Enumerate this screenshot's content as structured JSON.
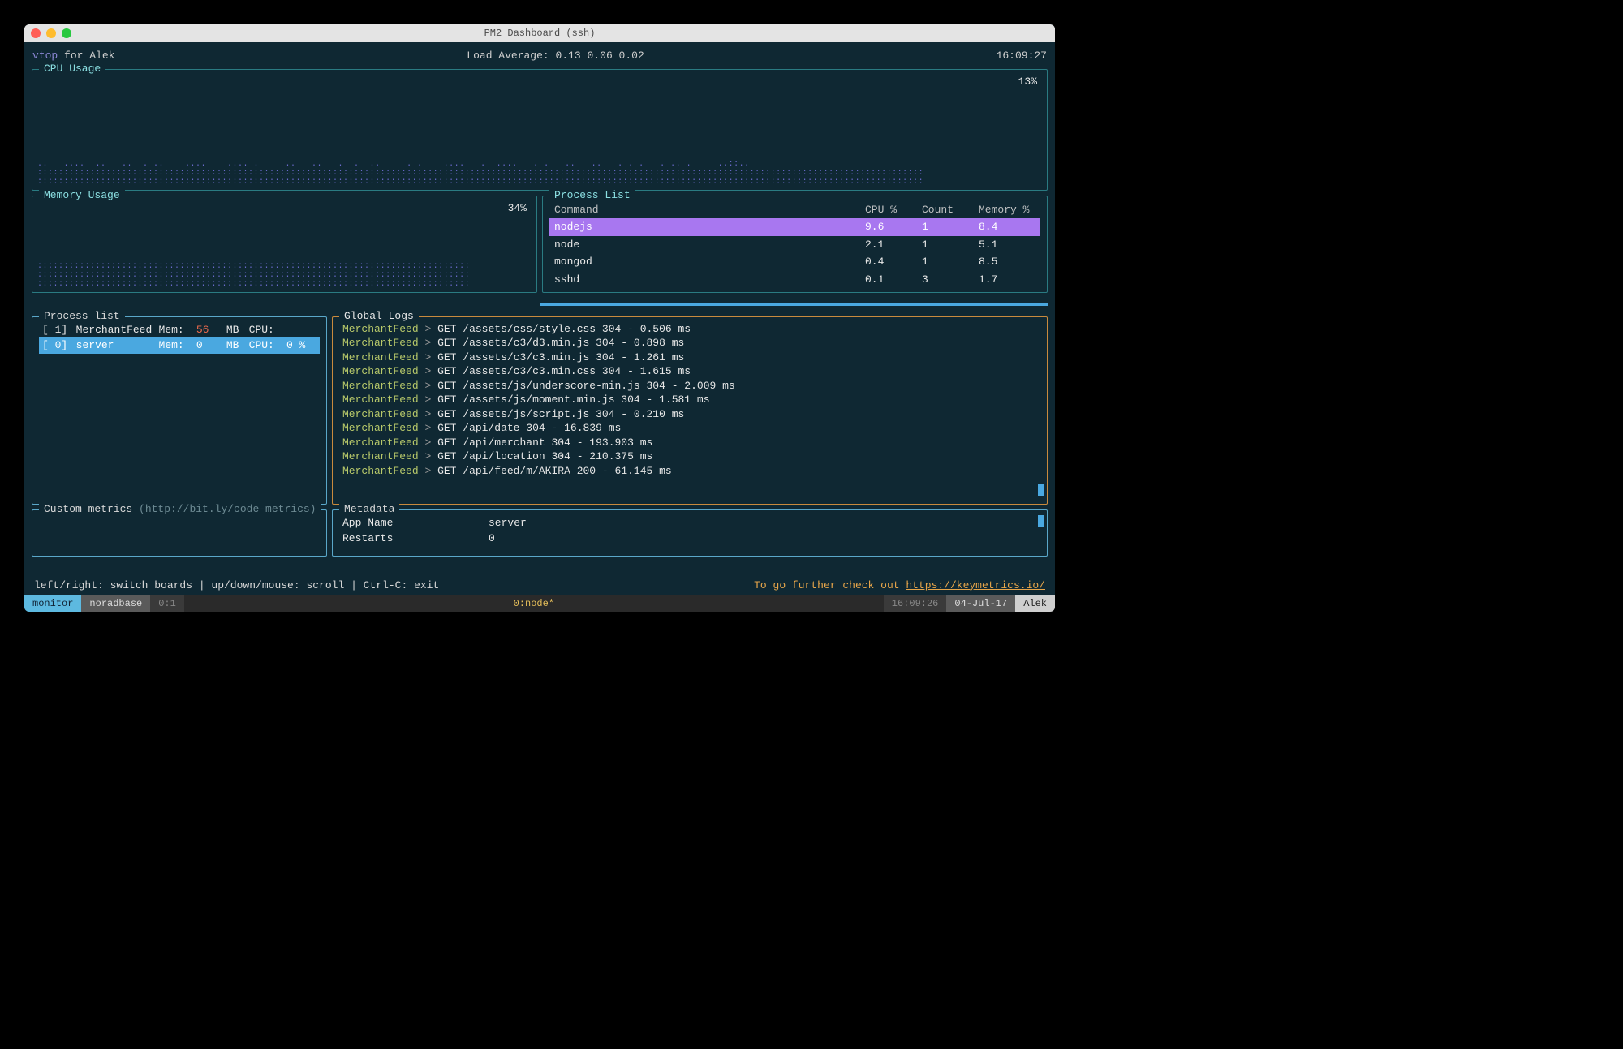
{
  "window": {
    "title": "PM2 Dashboard (ssh)"
  },
  "header": {
    "app": "vtop",
    "for": "for",
    "user": "Alek",
    "load_label": "Load Average:",
    "load": "0.13 0.06 0.02",
    "clock": "16:09:27"
  },
  "cpu": {
    "title": "CPU Usage",
    "pct": "13%"
  },
  "mem": {
    "title": "Memory Usage",
    "pct": "34%"
  },
  "proclist": {
    "title": "Process List",
    "head": {
      "cmd": "Command",
      "cpu": "CPU %",
      "count": "Count",
      "mem": "Memory %"
    },
    "rows": [
      {
        "cmd": "nodejs",
        "cpu": "9.6",
        "count": "1",
        "mem": "8.4",
        "sel": true
      },
      {
        "cmd": "node",
        "cpu": "2.1",
        "count": "1",
        "mem": "5.1"
      },
      {
        "cmd": "mongod",
        "cpu": "0.4",
        "count": "1",
        "mem": "8.5"
      },
      {
        "cmd": "sshd",
        "cpu": "0.1",
        "count": "3",
        "mem": "1.7"
      }
    ]
  },
  "pm2": {
    "proclist": {
      "title": "Process list",
      "rows": [
        {
          "id": "[ 1]",
          "name": "MerchantFeed",
          "memk": "Mem:",
          "memv": "56",
          "memu": "MB",
          "cpuk": "CPU:",
          "cpuv": "",
          "sel": false
        },
        {
          "id": "[ 0]",
          "name": "server",
          "memk": "Mem:",
          "memv": "0",
          "memu": "MB",
          "cpuk": "CPU:",
          "cpuv": "0 %",
          "sel": true
        }
      ]
    },
    "logs": {
      "title": "Global Logs",
      "lines": [
        {
          "src": "MerchantFeed",
          "msg": "GET /assets/css/style.css 304 - 0.506 ms"
        },
        {
          "src": "MerchantFeed",
          "msg": "GET /assets/c3/d3.min.js 304 - 0.898 ms"
        },
        {
          "src": "MerchantFeed",
          "msg": "GET /assets/c3/c3.min.js 304 - 1.261 ms"
        },
        {
          "src": "MerchantFeed",
          "msg": "GET /assets/c3/c3.min.css 304 - 1.615 ms"
        },
        {
          "src": "MerchantFeed",
          "msg": "GET /assets/js/underscore-min.js 304 - 2.009 ms"
        },
        {
          "src": "MerchantFeed",
          "msg": "GET /assets/js/moment.min.js 304 - 1.581 ms"
        },
        {
          "src": "MerchantFeed",
          "msg": "GET /assets/js/script.js 304 - 0.210 ms"
        },
        {
          "src": "MerchantFeed",
          "msg": "GET /api/date 304 - 16.839 ms"
        },
        {
          "src": "MerchantFeed",
          "msg": "GET /api/merchant 304 - 193.903 ms"
        },
        {
          "src": "MerchantFeed",
          "msg": "GET /api/location 304 - 210.375 ms"
        },
        {
          "src": "MerchantFeed",
          "msg": "GET /api/feed/m/AKIRA 200 - 61.145 ms"
        }
      ]
    },
    "custom": {
      "title": "Custom metrics",
      "hint": "(http://bit.ly/code-metrics)"
    },
    "meta": {
      "title": "Metadata",
      "rows": [
        {
          "k": "App Name",
          "v": "server"
        },
        {
          "k": "Restarts",
          "v": "0"
        }
      ]
    }
  },
  "help": {
    "left": "left/right: switch boards | up/down/mouse: scroll | Ctrl-C: exit",
    "right_pre": "To go further check out ",
    "right_link": "https://keymetrics.io/"
  },
  "tmux": {
    "monitor": "monitor",
    "norad": "noradbase",
    "zero": "0:1",
    "center": "0:node*",
    "time": "16:09:26",
    "date": "04-Jul-17",
    "user": "Alek"
  }
}
